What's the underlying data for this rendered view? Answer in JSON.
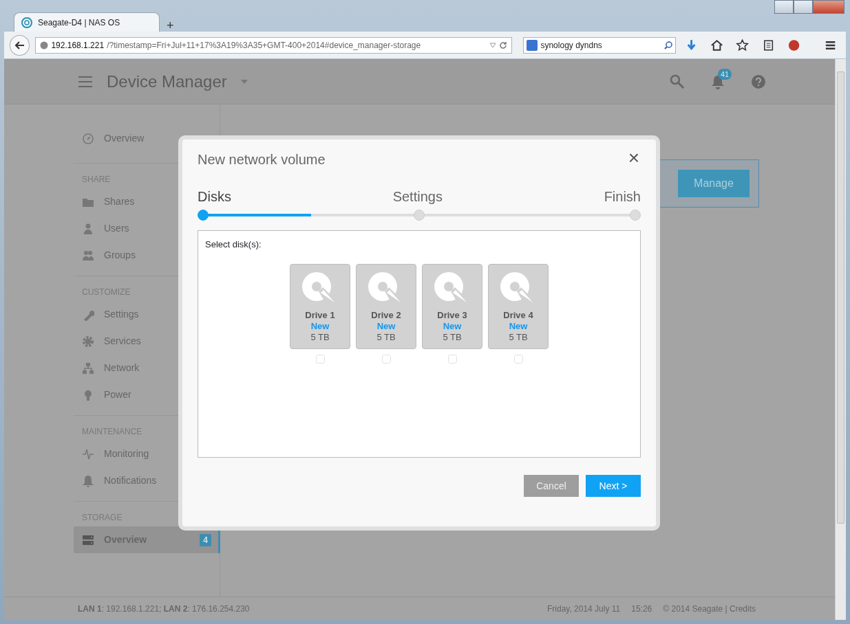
{
  "browser": {
    "tab_title": "Seagate-D4 | NAS OS",
    "new_tab": "+",
    "url_host": "192.168.1.221",
    "url_path": "/?timestamp=Fri+Jul+11+17%3A19%3A35+GMT-400+2014#device_manager-storage",
    "search_value": "synology dyndns"
  },
  "header": {
    "title": "Device Manager",
    "notification_count": "41"
  },
  "sidebar": {
    "sections": [
      {
        "items": [
          {
            "label": "Overview",
            "selected": false
          }
        ]
      },
      {
        "heading": "SHARE",
        "items": [
          {
            "label": "Shares",
            "selected": false
          },
          {
            "label": "Users",
            "selected": false
          },
          {
            "label": "Groups",
            "selected": false
          }
        ]
      },
      {
        "heading": "CUSTOMIZE",
        "items": [
          {
            "label": "Settings",
            "selected": false
          },
          {
            "label": "Services",
            "selected": false
          },
          {
            "label": "Network",
            "selected": false
          },
          {
            "label": "Power",
            "selected": false
          }
        ]
      },
      {
        "heading": "MAINTENANCE",
        "items": [
          {
            "label": "Monitoring",
            "selected": false
          },
          {
            "label": "Notifications",
            "selected": false
          }
        ]
      },
      {
        "heading": "STORAGE",
        "items": [
          {
            "label": "Overview",
            "selected": true,
            "badge": "4"
          }
        ]
      }
    ]
  },
  "content": {
    "manage_button": "Manage"
  },
  "modal": {
    "title": "New network volume",
    "close": "×",
    "steps": [
      {
        "label": "Disks",
        "selected": true
      },
      {
        "label": "Settings",
        "selected": false
      },
      {
        "label": "Finish",
        "selected": false
      }
    ],
    "level": 0.25,
    "prompt": "Select disk(s):",
    "drives": [
      {
        "name": "Drive 1",
        "status": "New",
        "size": "5 TB",
        "checked": false
      },
      {
        "name": "Drive 2",
        "status": "New",
        "size": "5 TB",
        "checked": false
      },
      {
        "name": "Drive 3",
        "status": "New",
        "size": "5 TB",
        "checked": false
      },
      {
        "name": "Drive 4",
        "status": "New",
        "size": "5 TB",
        "checked": false
      }
    ],
    "buttons": [
      {
        "label": "Cancel",
        "kind": "secondary"
      },
      {
        "label": "Next >",
        "kind": "primary"
      }
    ]
  },
  "footer": {
    "lan": "**LAN 1**: 192.168.1.221; **LAN 2**: 176.16.254.230",
    "date": "Friday, 2014 July 11",
    "time": "15:26",
    "copyright": "© 2014 Seagate | Credits"
  }
}
